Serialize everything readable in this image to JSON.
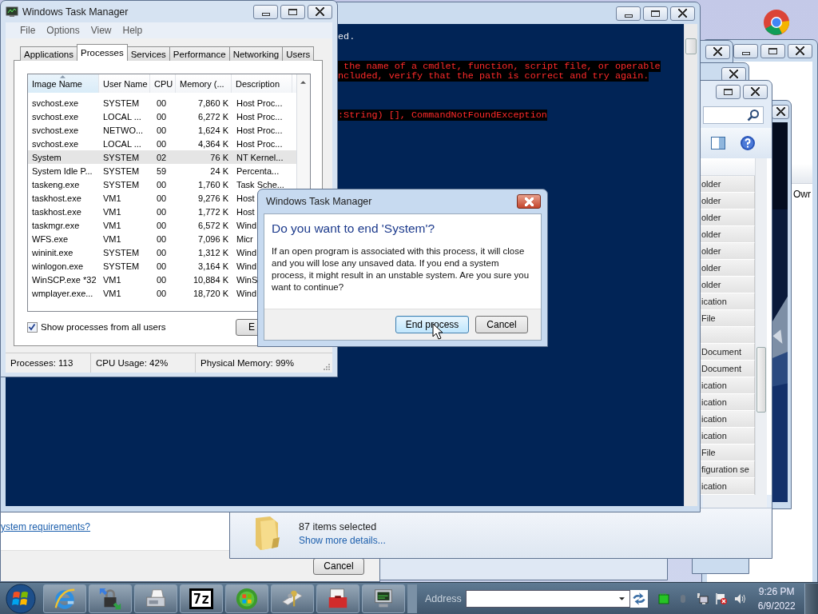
{
  "task_manager": {
    "title": "Windows Task Manager",
    "menu": [
      "File",
      "Options",
      "View",
      "Help"
    ],
    "tabs": [
      {
        "label": "Applications",
        "selected": false
      },
      {
        "label": "Processes",
        "selected": true
      },
      {
        "label": "Services",
        "selected": false
      },
      {
        "label": "Performance",
        "selected": false
      },
      {
        "label": "Networking",
        "selected": false
      },
      {
        "label": "Users",
        "selected": false
      }
    ],
    "columns": [
      "Image Name",
      "User Name",
      "CPU",
      "Memory (...",
      "Description"
    ],
    "rows": [
      {
        "cells": [
          "svchost.exe",
          "SYSTEM",
          "00",
          "7,860 K",
          "Host Proc..."
        ],
        "selected": false
      },
      {
        "cells": [
          "svchost.exe",
          "LOCAL ...",
          "00",
          "6,272 K",
          "Host Proc..."
        ],
        "selected": false
      },
      {
        "cells": [
          "svchost.exe",
          "NETWO...",
          "00",
          "1,624 K",
          "Host Proc..."
        ],
        "selected": false
      },
      {
        "cells": [
          "svchost.exe",
          "LOCAL ...",
          "00",
          "4,364 K",
          "Host Proc..."
        ],
        "selected": false
      },
      {
        "cells": [
          "System",
          "SYSTEM",
          "02",
          "76 K",
          "NT Kernel..."
        ],
        "selected": true
      },
      {
        "cells": [
          "System Idle P...",
          "SYSTEM",
          "59",
          "24 K",
          "Percenta..."
        ],
        "selected": false
      },
      {
        "cells": [
          "taskeng.exe",
          "SYSTEM",
          "00",
          "1,760 K",
          "Task Sche..."
        ],
        "selected": false
      },
      {
        "cells": [
          "taskhost.exe",
          "VM1",
          "00",
          "9,276 K",
          "Host"
        ],
        "selected": false
      },
      {
        "cells": [
          "taskhost.exe",
          "VM1",
          "00",
          "1,772 K",
          "Host"
        ],
        "selected": false
      },
      {
        "cells": [
          "taskmgr.exe",
          "VM1",
          "00",
          "6,572 K",
          "Wind"
        ],
        "selected": false
      },
      {
        "cells": [
          "WFS.exe",
          "VM1",
          "00",
          "7,096 K",
          "Micr"
        ],
        "selected": false
      },
      {
        "cells": [
          "wininit.exe",
          "SYSTEM",
          "00",
          "1,312 K",
          "Wind"
        ],
        "selected": false
      },
      {
        "cells": [
          "winlogon.exe",
          "SYSTEM",
          "00",
          "3,164 K",
          "Wind"
        ],
        "selected": false
      },
      {
        "cells": [
          "WinSCP.exe *32",
          "VM1",
          "00",
          "10,884 K",
          "WinS"
        ],
        "selected": false
      },
      {
        "cells": [
          "wmplayer.exe...",
          "VM1",
          "00",
          "18,720 K",
          "Wind"
        ],
        "selected": false
      }
    ],
    "show_all_users": {
      "label": "Show processes from all users",
      "checked": true
    },
    "end_button": "E",
    "status_bar": [
      "Processes: 113",
      "CPU Usage: 42%",
      "Physical Memory: 99%"
    ]
  },
  "console": {
    "blocks": [
      {
        "kind": "output",
        "lines": [
          "ed."
        ]
      },
      {
        "kind": "error",
        "lines": [
          " the name of a cmdlet, function, script file, or operable",
          "ncluded, verify that the path is correct and try again."
        ]
      },
      {
        "kind": "error",
        "lines": [
          ":String) [], CommandNotFoundException"
        ]
      }
    ]
  },
  "dialog": {
    "title": "Windows Task Manager",
    "heading": "Do you want to end 'System'?",
    "message": "If an open program is associated with this process, it will close and you will lose any unsaved data. If you end a system process, it might result in an unstable system. Are you sure you want to continue?",
    "buttons": [
      {
        "label": "End process",
        "selected": true
      },
      {
        "label": "Cancel",
        "selected": false
      }
    ]
  },
  "back_window": {
    "column_text": "Owr"
  },
  "explorer": {
    "rows": [
      {
        "kind": "entry",
        "type": "older"
      },
      {
        "kind": "entry",
        "type": "older"
      },
      {
        "kind": "entry",
        "type": "older"
      },
      {
        "kind": "entry",
        "type": "older"
      },
      {
        "kind": "entry",
        "type": "older"
      },
      {
        "kind": "entry",
        "type": "older"
      },
      {
        "kind": "entry",
        "type": "older"
      },
      {
        "kind": "entry",
        "type": "ication"
      },
      {
        "kind": "entry",
        "type": "File"
      },
      {
        "kind": "blank"
      },
      {
        "kind": "entry",
        "type": "Document"
      },
      {
        "kind": "entry",
        "type": "Document"
      },
      {
        "kind": "entry",
        "type": "ication"
      },
      {
        "kind": "entry",
        "type": "ication"
      },
      {
        "kind": "entry",
        "type": "ication"
      },
      {
        "kind": "entry",
        "type": "ication"
      },
      {
        "kind": "entry",
        "type": "File"
      },
      {
        "kind": "entry",
        "type": "figuration se"
      },
      {
        "kind": "entry",
        "type": "ication"
      }
    ],
    "selection": "87 items selected",
    "details_link": "Show more details..."
  },
  "setup_window": {
    "link": "ystem requirements?",
    "cancel": "Cancel"
  },
  "taskbar": {
    "pinned": [
      {
        "kind": "ie"
      },
      {
        "kind": "lock"
      },
      {
        "kind": "fax"
      },
      {
        "kind": "archiver",
        "label": "7z"
      },
      {
        "kind": "media"
      },
      {
        "kind": "keys"
      },
      {
        "kind": "toolbox"
      },
      {
        "kind": "monitor"
      }
    ],
    "address_label": "Address",
    "time": "9:26 PM",
    "date": "6/9/2022"
  }
}
